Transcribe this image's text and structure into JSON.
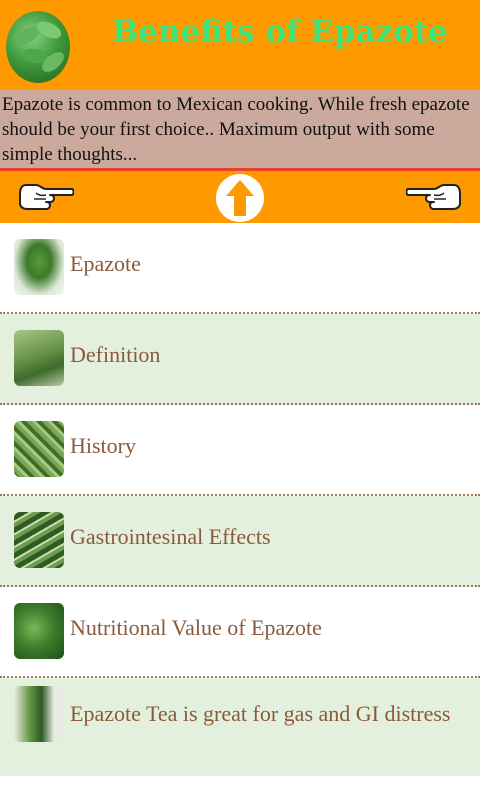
{
  "app": {
    "title": "Benefits of Epazote",
    "description": "Epazote is common to Mexican cooking. While fresh epazote should be your first choice.. Maximum output with some simple thoughts..."
  },
  "nav": {
    "left_icon": "pointing-hand-left-icon",
    "center_icon": "up-arrow-icon",
    "right_icon": "pointing-hand-right-icon"
  },
  "colors": {
    "header_bg": "#ff9900",
    "title": "#3ee17a",
    "desc_bg": "#cba99c",
    "alt_row": "#e2f0dd",
    "item_text": "#8a5a3a"
  },
  "items": [
    {
      "label": "Epazote"
    },
    {
      "label": "Definition"
    },
    {
      "label": "History"
    },
    {
      "label": "Gastrointesinal Effects"
    },
    {
      "label": "Nutritional Value of Epazote"
    },
    {
      "label": "Epazote Tea is great for gas and GI distress"
    }
  ]
}
